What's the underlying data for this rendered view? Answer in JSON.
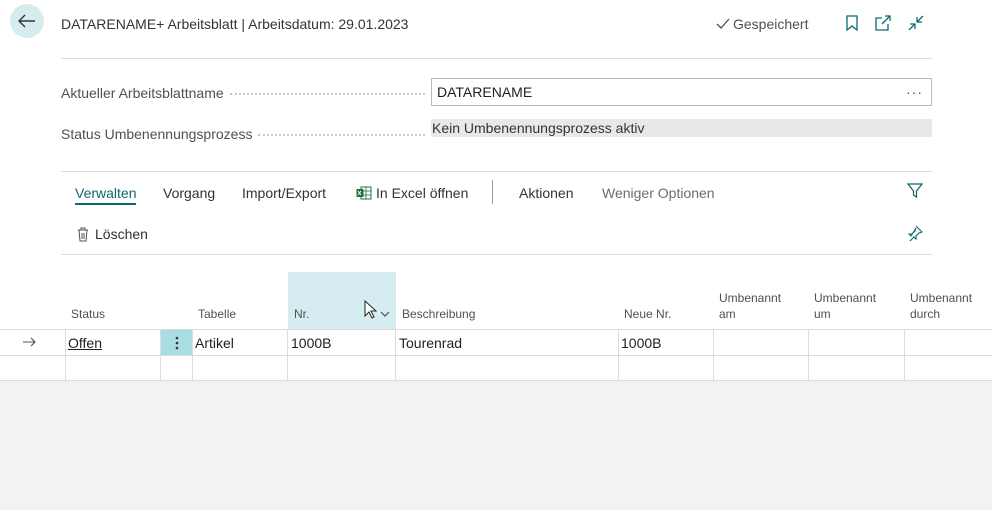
{
  "header": {
    "title": "DATARENAME+ Arbeitsblatt | Arbeitsdatum: 29.01.2023",
    "saved_label": "Gespeichert"
  },
  "fields": {
    "worksheet_name": {
      "label": "Aktueller Arbeitsblattname",
      "value": "DATARENAME",
      "assist": "···"
    },
    "rename_status": {
      "label": "Status Umbenennungsprozess",
      "value": "Kein Umbenennungsprozess aktiv"
    }
  },
  "actions": {
    "manage": "Verwalten",
    "process": "Vorgang",
    "import_export": "Import/Export",
    "open_excel": "In Excel öffnen",
    "actions": "Aktionen",
    "fewer_options": "Weniger Optionen",
    "delete": "Löschen"
  },
  "table": {
    "columns": {
      "status": "Status",
      "table": "Tabelle",
      "no": "Nr.",
      "description": "Beschreibung",
      "new_no": "Neue Nr.",
      "renamed_on_1": "Umbenannt",
      "renamed_on_2": "am",
      "renamed_at_1": "Umbenannt",
      "renamed_at_2": "um",
      "renamed_by_1": "Umbenannt",
      "renamed_by_2": "durch"
    },
    "rows": [
      {
        "status": "Offen",
        "table": "Artikel",
        "no": "1000B",
        "description": "Tourenrad",
        "new_no": "1000B",
        "renamed_on": "",
        "renamed_at": "",
        "renamed_by": ""
      }
    ]
  },
  "colors": {
    "accent": "#0b6a6f",
    "selected_column": "#d5edf0",
    "back_button": "#d7eced"
  }
}
